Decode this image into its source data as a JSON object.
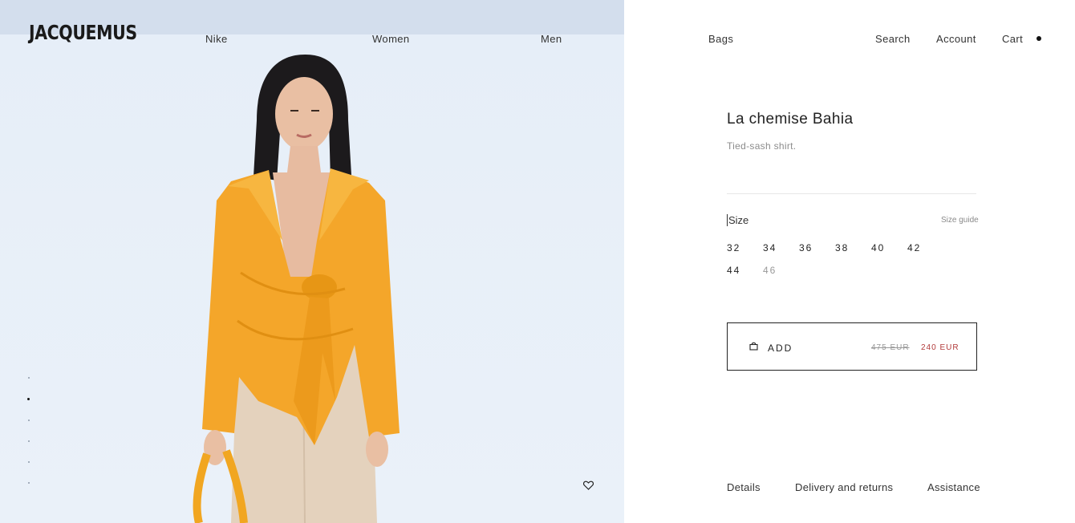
{
  "brand": {
    "logo": "JACQUEMUS"
  },
  "nav": {
    "left": [
      "Nike",
      "Women",
      "Men",
      "Bags"
    ],
    "search": "Search",
    "account": "Account",
    "cart": "Cart"
  },
  "product": {
    "title": "La chemise Bahia",
    "subtitle": "Tied-sash shirt.",
    "size_label": "Size",
    "size_guide": "Size guide",
    "sizes": [
      {
        "label": "32",
        "available": true
      },
      {
        "label": "34",
        "available": true
      },
      {
        "label": "36",
        "available": true
      },
      {
        "label": "38",
        "available": true
      },
      {
        "label": "40",
        "available": true
      },
      {
        "label": "42",
        "available": true
      },
      {
        "label": "44",
        "available": true
      },
      {
        "label": "46",
        "available": false
      }
    ],
    "add_label": "ADD",
    "old_price": "475 EUR",
    "new_price": "240 EUR"
  },
  "gallery": {
    "slide_count": 6,
    "active_index": 1
  },
  "info_links": [
    "Details",
    "Delivery and returns",
    "Assistance"
  ],
  "icons": {
    "bag": "shopping-bag-icon",
    "favorite": "heart-icon"
  },
  "colors": {
    "sale": "#b23a3a",
    "hero_bg": "#e6eef8",
    "shirt": "#f4a62a"
  }
}
